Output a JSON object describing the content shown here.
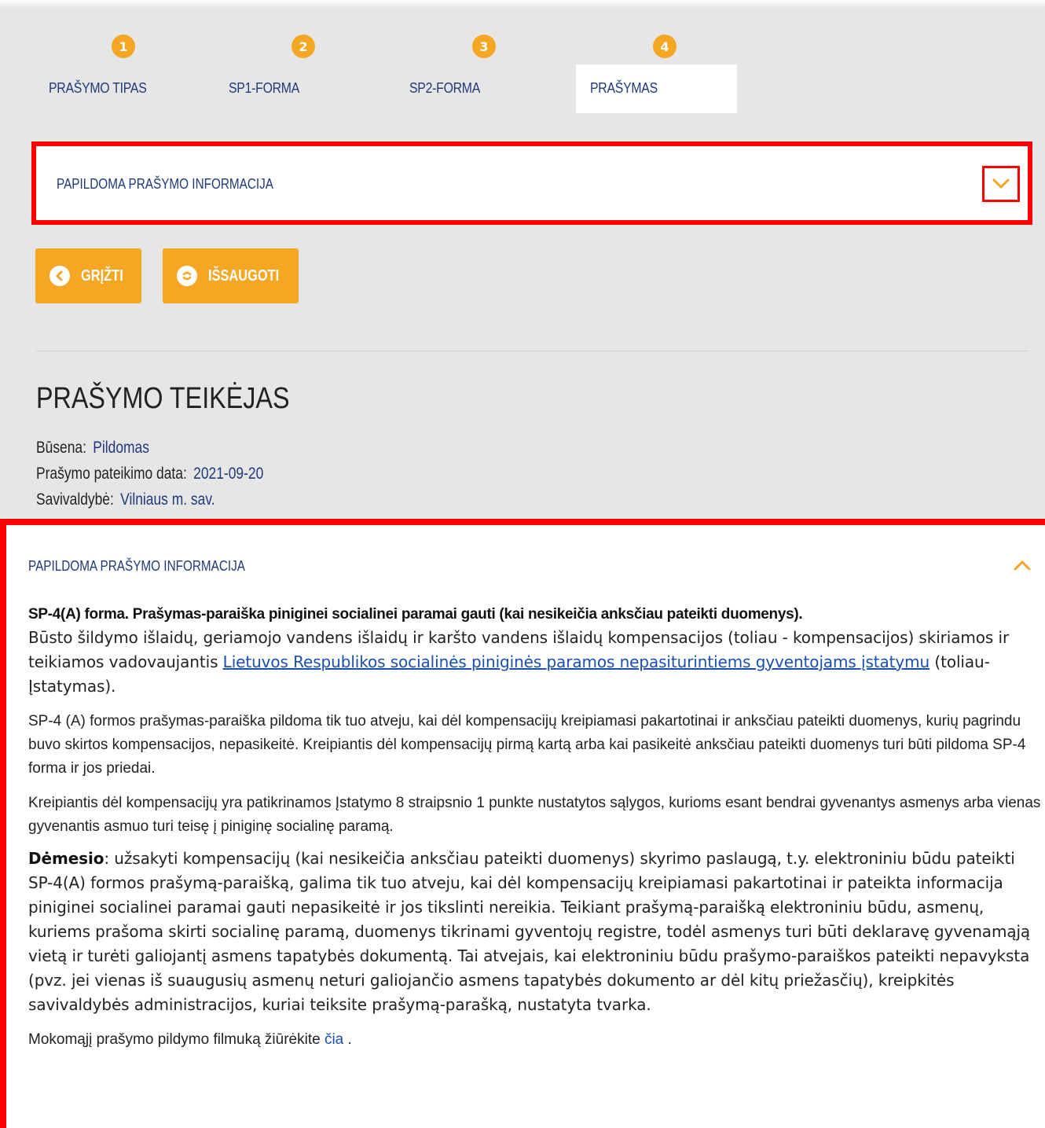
{
  "steps": [
    {
      "num": "1",
      "label": "PRAŠYMO TIPAS",
      "active": false
    },
    {
      "num": "2",
      "label": "SP1-FORMA",
      "active": false
    },
    {
      "num": "3",
      "label": "SP2-FORMA",
      "active": false
    },
    {
      "num": "4",
      "label": "PRAŠYMAS",
      "active": true
    }
  ],
  "accordion_collapsed": {
    "title": "PAPILDOMA PRAŠYMO INFORMACIJA"
  },
  "buttons": {
    "back_label": "GRĮŽTI",
    "save_label": "IŠSAUGOTI"
  },
  "applicant": {
    "title": "PRAŠYMO TEIKĖJAS",
    "status_label": "Būsena:",
    "status_value": "Pildomas",
    "date_label": "Prašymo pateikimo data:",
    "date_value": "2021-09-20",
    "municipality_label": "Savivaldybė:",
    "municipality_value": "Vilniaus m. sav."
  },
  "accordion_expanded": {
    "title": "PAPILDOMA PRAŠYMO INFORMACIJA",
    "lead_bold": "SP-4(A) forma. Prašymas-paraiška piniginei socialinei paramai gauti (kai nesikeičia anksčiau pateikti duomenys).",
    "p1_before_link": "Būsto šildymo išlaidų, geriamojo vandens išlaidų ir karšto vandens išlaidų kompensacijos (toliau - kompensacijos) skiriamos ir teikiamos vadovaujantis ",
    "p1_link": "Lietuvos Respublikos socialinės piniginės paramos nepasiturintiems gyventojams įstatymu",
    "p1_after_link": " (toliau- Įstatymas).",
    "p2": "SP-4 (A) formos prašymas-paraiška pildoma tik tuo atveju, kai dėl kompensacijų kreipiamasi pakartotinai ir anksčiau pateikti duomenys, kurių pagrindu buvo skirtos kompensacijos, nepasikeitė. Kreipiantis dėl kompensacijų pirmą kartą arba kai pasikeitė anksčiau pateikti duomenys turi būti pildoma SP-4 forma ir jos priedai.",
    "p3": "Kreipiantis dėl kompensacijų yra patikrinamos Įstatymo 8 straipsnio 1 punkte nustatytos sąlygos, kurioms esant bendrai gyvenantys asmenys arba vienas gyvenantis asmuo turi teisę į piniginę socialinę paramą.",
    "notice_bold": "Dėmesio",
    "notice_text": ": užsakyti kompensacijų (kai nesikeičia anksčiau pateikti duomenys) skyrimo paslaugą, t.y. elektroniniu būdu pateikti SP-4(A) formos prašymą-paraišką, galima tik tuo atveju, kai dėl kompensacijų kreipiamasi pakartotinai ir pateikta informacija piniginei socialinei paramai gauti nepasikeitė ir jos tikslinti nereikia. Teikiant prašymą-paraišką elektroniniu būdu, asmenų, kuriems prašoma skirti socialinę paramą, duomenys tikrinami gyventojų registre, todėl asmenys turi būti deklaravę gyvenamąją vietą ir turėti galiojantį asmens tapatybės dokumentą. Tai atvejais, kai elektroniniu būdu prašymo-paraiškos pateikti nepavyksta (pvz. jei vienas iš suaugusių asmenų neturi galiojančio asmens tapatybės dokumento ar dėl kitų priežasčių), kreipkitės savivaldybės administracijos, kuriai teiksite prašymą-parašką, nustatyta tvarka.",
    "video_text": "Mokomąjį prašymo pildymo filmuką žiūrėkite ",
    "video_link": "čia",
    "video_after": " ."
  },
  "colors": {
    "accent": "#f5a623",
    "highlight": "#ff0000",
    "link": "#1f3a7a"
  },
  "icons": {
    "chevron_down": "chevron-down-icon",
    "chevron_up": "chevron-up-icon",
    "back": "arrow-left-circle-icon",
    "save": "save-circle-icon"
  }
}
